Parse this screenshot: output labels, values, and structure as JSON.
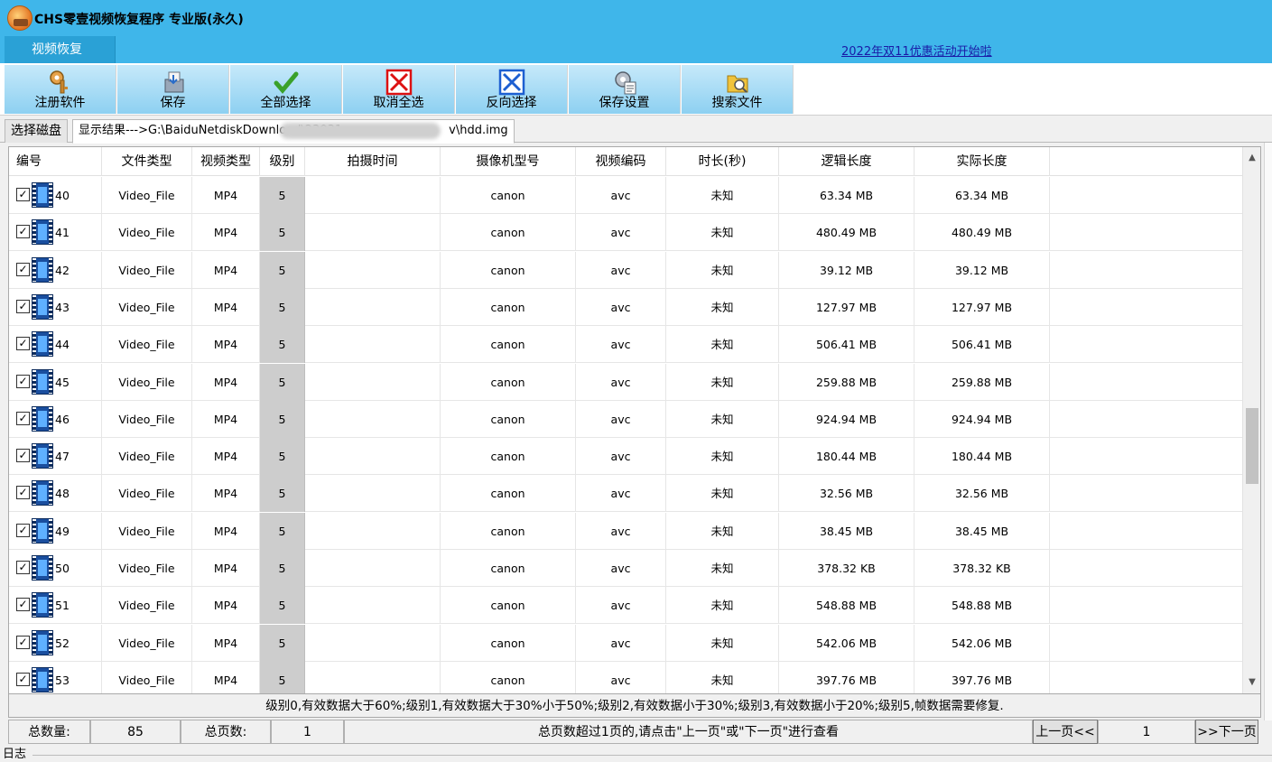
{
  "window": {
    "title": "CHS零壹视频恢复程序 专业版(永久)"
  },
  "menu": {
    "active_tab": "视频恢复",
    "promo_link": "2022年双11优惠活动开始啦"
  },
  "toolbar": [
    {
      "label": "注册软件",
      "icon": "key-icon"
    },
    {
      "label": "保存",
      "icon": "save-disk-icon"
    },
    {
      "label": "全部选择",
      "icon": "green-check-icon"
    },
    {
      "label": "取消全选",
      "icon": "red-x-box-icon"
    },
    {
      "label": "反向选择",
      "icon": "blue-x-box-icon"
    },
    {
      "label": "保存设置",
      "icon": "settings-doc-icon"
    },
    {
      "label": "搜索文件",
      "icon": "folder-search-icon"
    }
  ],
  "tabs": {
    "disk": "选择磁盘",
    "result_prefix": "显示结果--->G:\\BaiduNetdiskDownload\\23031",
    "result_suffix": "v\\hdd.img"
  },
  "table": {
    "columns": [
      "编号",
      "文件类型",
      "视频类型",
      "级别",
      "拍摄时间",
      "摄像机型号",
      "视频编码",
      "时长(秒)",
      "逻辑长度",
      "实际长度"
    ],
    "rows": [
      {
        "id": "40",
        "file_type": "Video_File",
        "video_type": "MP4",
        "level": "5",
        "time": "",
        "camera": "canon",
        "codec": "avc",
        "duration": "未知",
        "logical": "63.34 MB",
        "actual": "63.34 MB",
        "checked": true
      },
      {
        "id": "41",
        "file_type": "Video_File",
        "video_type": "MP4",
        "level": "5",
        "time": "",
        "camera": "canon",
        "codec": "avc",
        "duration": "未知",
        "logical": "480.49 MB",
        "actual": "480.49 MB",
        "checked": true
      },
      {
        "id": "42",
        "file_type": "Video_File",
        "video_type": "MP4",
        "level": "5",
        "time": "",
        "camera": "canon",
        "codec": "avc",
        "duration": "未知",
        "logical": "39.12 MB",
        "actual": "39.12 MB",
        "checked": true
      },
      {
        "id": "43",
        "file_type": "Video_File",
        "video_type": "MP4",
        "level": "5",
        "time": "",
        "camera": "canon",
        "codec": "avc",
        "duration": "未知",
        "logical": "127.97 MB",
        "actual": "127.97 MB",
        "checked": true
      },
      {
        "id": "44",
        "file_type": "Video_File",
        "video_type": "MP4",
        "level": "5",
        "time": "",
        "camera": "canon",
        "codec": "avc",
        "duration": "未知",
        "logical": "506.41 MB",
        "actual": "506.41 MB",
        "checked": true
      },
      {
        "id": "45",
        "file_type": "Video_File",
        "video_type": "MP4",
        "level": "5",
        "time": "",
        "camera": "canon",
        "codec": "avc",
        "duration": "未知",
        "logical": "259.88 MB",
        "actual": "259.88 MB",
        "checked": true
      },
      {
        "id": "46",
        "file_type": "Video_File",
        "video_type": "MP4",
        "level": "5",
        "time": "",
        "camera": "canon",
        "codec": "avc",
        "duration": "未知",
        "logical": "924.94 MB",
        "actual": "924.94 MB",
        "checked": true
      },
      {
        "id": "47",
        "file_type": "Video_File",
        "video_type": "MP4",
        "level": "5",
        "time": "",
        "camera": "canon",
        "codec": "avc",
        "duration": "未知",
        "logical": "180.44 MB",
        "actual": "180.44 MB",
        "checked": true
      },
      {
        "id": "48",
        "file_type": "Video_File",
        "video_type": "MP4",
        "level": "5",
        "time": "",
        "camera": "canon",
        "codec": "avc",
        "duration": "未知",
        "logical": "32.56 MB",
        "actual": "32.56 MB",
        "checked": true
      },
      {
        "id": "49",
        "file_type": "Video_File",
        "video_type": "MP4",
        "level": "5",
        "time": "",
        "camera": "canon",
        "codec": "avc",
        "duration": "未知",
        "logical": "38.45 MB",
        "actual": "38.45 MB",
        "checked": true
      },
      {
        "id": "50",
        "file_type": "Video_File",
        "video_type": "MP4",
        "level": "5",
        "time": "",
        "camera": "canon",
        "codec": "avc",
        "duration": "未知",
        "logical": "378.32 KB",
        "actual": "378.32 KB",
        "checked": true
      },
      {
        "id": "51",
        "file_type": "Video_File",
        "video_type": "MP4",
        "level": "5",
        "time": "",
        "camera": "canon",
        "codec": "avc",
        "duration": "未知",
        "logical": "548.88 MB",
        "actual": "548.88 MB",
        "checked": true
      },
      {
        "id": "52",
        "file_type": "Video_File",
        "video_type": "MP4",
        "level": "5",
        "time": "",
        "camera": "canon",
        "codec": "avc",
        "duration": "未知",
        "logical": "542.06 MB",
        "actual": "542.06 MB",
        "checked": true
      },
      {
        "id": "53",
        "file_type": "Video_File",
        "video_type": "MP4",
        "level": "5",
        "time": "",
        "camera": "canon",
        "codec": "avc",
        "duration": "未知",
        "logical": "397.76 MB",
        "actual": "397.76 MB",
        "checked": true
      }
    ]
  },
  "legend": "级别0,有效数据大于60%;级别1,有效数据大于30%小于50%;级别2,有效数据小于30%;级别3,有效数据小于20%;级别5,帧数据需要修复.",
  "status": {
    "total_label": "总数量:",
    "total_value": "85",
    "pages_label": "总页数:",
    "pages_value": "1",
    "hint": "总页数超过1页的,请点击\"上一页\"或\"下一页\"进行查看",
    "prev_button": "上一页<<",
    "current_page": "1",
    "next_button": ">>下一页"
  },
  "log_label": "日志"
}
